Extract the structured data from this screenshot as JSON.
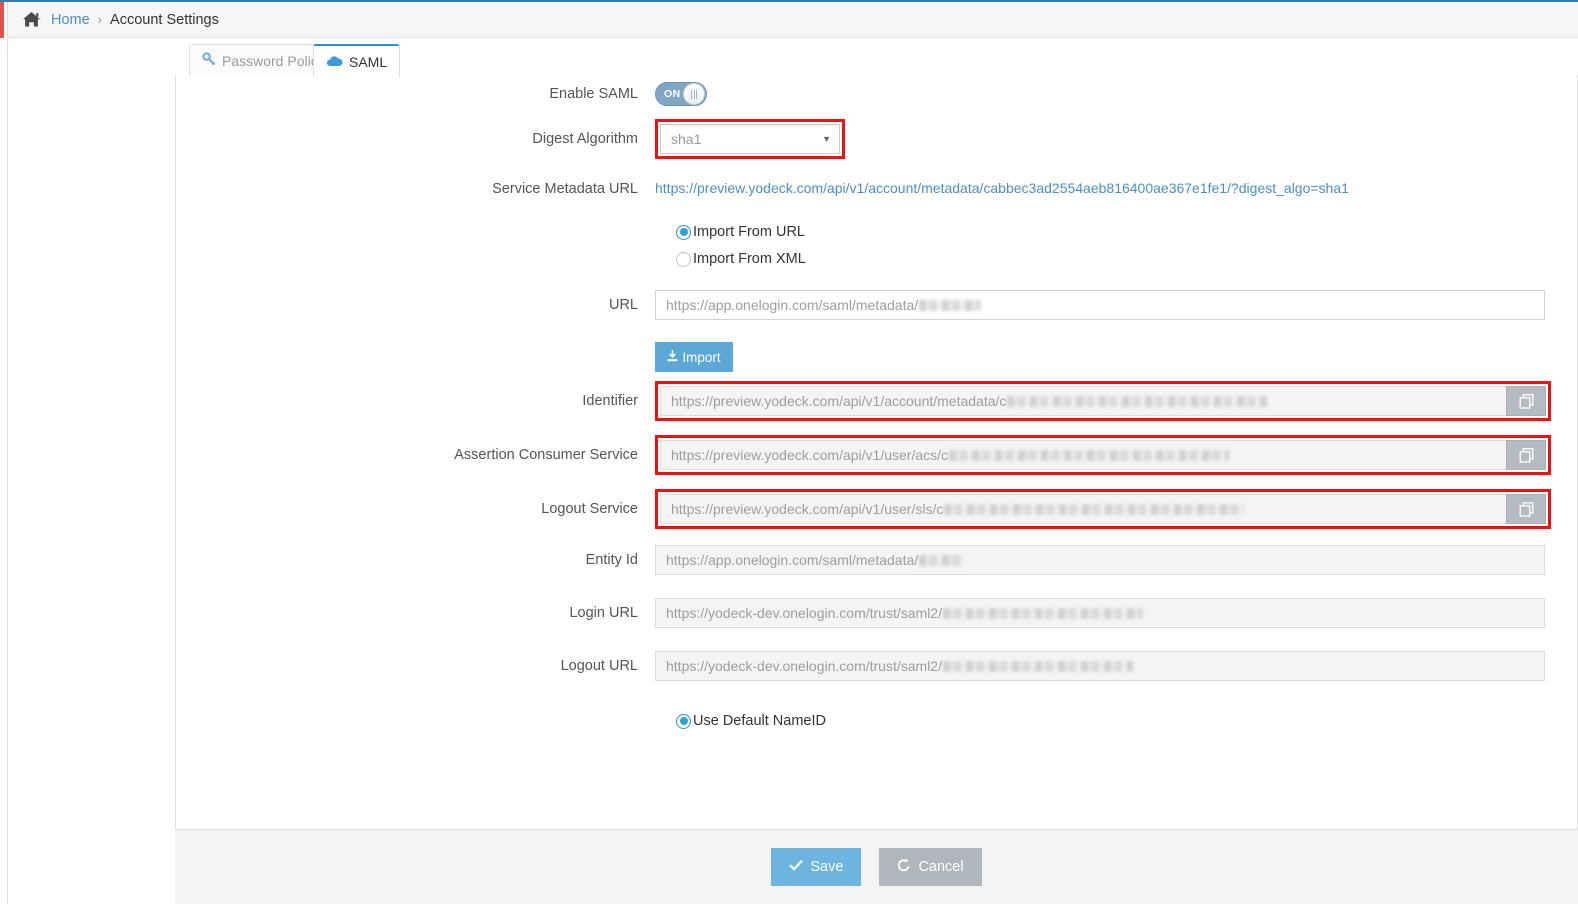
{
  "breadcrumb": {
    "home_label": "Home",
    "separator": "›",
    "current": "Account Settings",
    "home_icon": "home-icon"
  },
  "tabs": [
    {
      "label": "Password Policy",
      "icon": "key-icon",
      "active": false
    },
    {
      "label": "SAML",
      "icon": "cloud-icon",
      "active": true
    }
  ],
  "form": {
    "enable_saml": {
      "label": "Enable SAML",
      "toggle_state": "ON"
    },
    "digest_algorithm": {
      "label": "Digest Algorithm",
      "value": "sha1",
      "caret": "▼",
      "highlighted": true
    },
    "service_metadata_url": {
      "label": "Service Metadata URL",
      "link_text": "https://preview.yodeck.com/api/v1/account/metadata/cabbec3ad2554aeb816400ae367e1fe1/?digest_algo=sha1"
    },
    "import_options": [
      {
        "label": "Import From URL",
        "checked": true
      },
      {
        "label": "Import From XML",
        "checked": false
      }
    ],
    "url": {
      "label": "URL",
      "value": "https://app.onelogin.com/saml/metadata/",
      "redacted": true,
      "redacted_width": 62
    },
    "import_button": {
      "label": "Import",
      "icon": "download-icon"
    },
    "identifier": {
      "label": "Identifier",
      "value": "https://preview.yodeck.com/api/v1/account/metadata/c",
      "redacted": true,
      "redacted_width": 260,
      "highlighted": true,
      "copy_icon": "copy-icon"
    },
    "assertion_consumer_service": {
      "label": "Assertion Consumer Service",
      "value": "https://preview.yodeck.com/api/v1/user/acs/c",
      "redacted": true,
      "redacted_width": 280,
      "highlighted": true,
      "copy_icon": "copy-icon"
    },
    "logout_service": {
      "label": "Logout Service",
      "value": "https://preview.yodeck.com/api/v1/user/sls/c",
      "redacted": true,
      "redacted_width": 300,
      "highlighted": true,
      "copy_icon": "copy-icon"
    },
    "entity_id": {
      "label": "Entity Id",
      "value": "https://app.onelogin.com/saml/metadata/",
      "redacted": true,
      "redacted_width": 46
    },
    "login_url": {
      "label": "Login URL",
      "value": "https://yodeck-dev.onelogin.com/trust/saml2/",
      "redacted": true,
      "redacted_width": 200
    },
    "logout_url": {
      "label": "Logout URL",
      "value": "https://yodeck-dev.onelogin.com/trust/saml2/",
      "redacted": true,
      "redacted_width": 190
    },
    "nameid_option": {
      "label": "Use Default NameID",
      "checked": true
    }
  },
  "footer": {
    "save_label": "Save",
    "save_icon": "check-icon",
    "cancel_label": "Cancel",
    "cancel_icon": "undo-icon"
  },
  "colors": {
    "accent": "#4b8fc4",
    "highlight": "#ee1111",
    "toggle_on": "#7fa7c4",
    "save": "#6eb4e0",
    "cancel": "#b0b7bc",
    "import": "#5ba7d6"
  }
}
